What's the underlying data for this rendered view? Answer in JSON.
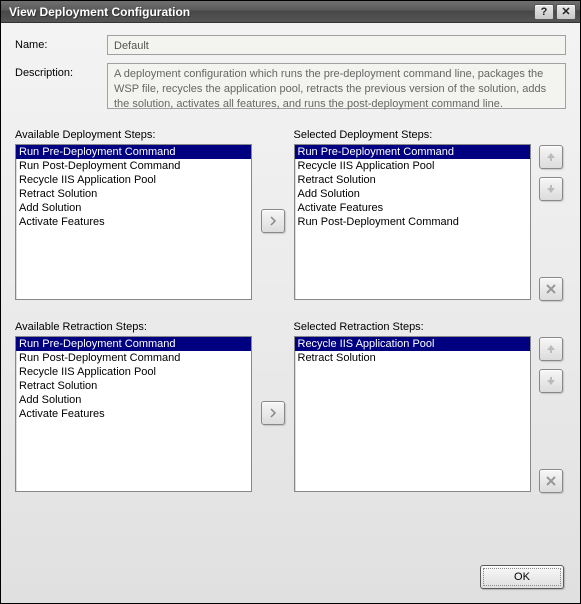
{
  "window": {
    "title": "View Deployment Configuration"
  },
  "form": {
    "name_label": "Name:",
    "name_value": "Default",
    "desc_label": "Description:",
    "desc_value": "A deployment configuration which runs the pre-deployment command line, packages the WSP file, recycles the application pool, retracts the previous version of the solution, adds the solution, activates all features, and runs the post-deployment command line."
  },
  "deploy": {
    "avail_label": "Available Deployment Steps:",
    "selected_label": "Selected Deployment Steps:",
    "available": [
      "Run Pre-Deployment Command",
      "Run Post-Deployment Command",
      "Recycle IIS Application Pool",
      "Retract Solution",
      "Add Solution",
      "Activate Features"
    ],
    "available_sel_index": 0,
    "selected": [
      "Run Pre-Deployment Command",
      "Recycle IIS Application Pool",
      "Retract Solution",
      "Add Solution",
      "Activate Features",
      "Run Post-Deployment Command"
    ],
    "selected_sel_index": 0
  },
  "retract": {
    "avail_label": "Available Retraction Steps:",
    "selected_label": "Selected Retraction Steps:",
    "available": [
      "Run Pre-Deployment Command",
      "Run Post-Deployment Command",
      "Recycle IIS Application Pool",
      "Retract Solution",
      "Add Solution",
      "Activate Features"
    ],
    "available_sel_index": 0,
    "selected": [
      "Recycle IIS Application Pool",
      "Retract Solution"
    ],
    "selected_sel_index": 0
  },
  "buttons": {
    "ok": "OK"
  },
  "icons": {
    "help": "?",
    "close": "✕"
  }
}
